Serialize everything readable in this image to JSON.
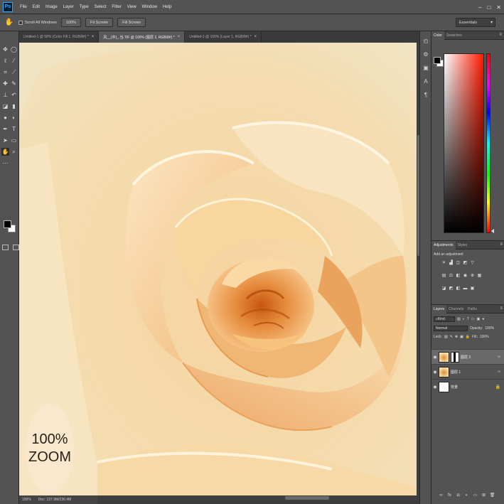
{
  "app": {
    "logo": "Ps"
  },
  "menu": [
    "File",
    "Edit",
    "Image",
    "Layer",
    "Type",
    "Select",
    "Filter",
    "View",
    "Window",
    "Help"
  ],
  "window_controls": [
    "–",
    "□",
    "✕"
  ],
  "options_bar": {
    "tool_icon": "hand-icon",
    "scroll_all_windows": "Scroll All Windows",
    "buttons": [
      "100%",
      "Fit Screen",
      "Fill Screen"
    ],
    "workspace": "Essentials"
  },
  "tabs": [
    {
      "label": "Untitled-1 @ 58% (Color Fill 1, RGB/8#) *",
      "active": false
    },
    {
      "label": "风__(中)_.当.TIF @ 100% (图层 2, RGB/8#) *",
      "active": true
    },
    {
      "label": "Untitled-2 @ 100% (Layer 1, RGB/8#) *",
      "active": false
    }
  ],
  "canvas": {
    "zoom_badge_line1": "100%",
    "zoom_badge_line2": "ZOOM"
  },
  "statusbar": {
    "zoom": "100%",
    "doc": "Doc: 137.9M/230.4M"
  },
  "color_panel": {
    "tabs": [
      "Color",
      "Swatches"
    ]
  },
  "adjustments_panel": {
    "tabs": [
      "Adjustments",
      "Styles"
    ],
    "hint": "Add an adjustment"
  },
  "layers_panel": {
    "tabs": [
      "Layers",
      "Channels",
      "Paths"
    ],
    "filter_kind": "Kind",
    "blend_mode": "Normal",
    "opacity_label": "Opacity:",
    "opacity_value": "100%",
    "lock_label": "Lock:",
    "fill_label": "Fill:",
    "fill_value": "100%",
    "layers": [
      {
        "name": "图层 2",
        "selected": true
      },
      {
        "name": "图层 1",
        "selected": false
      },
      {
        "name": "背景",
        "selected": false
      }
    ]
  },
  "colors": {
    "foreground": "#000000",
    "background": "#ffffff",
    "ui_dark": "#535353",
    "rose_light": "#f3e2bd",
    "rose_core": "#d6701f"
  }
}
